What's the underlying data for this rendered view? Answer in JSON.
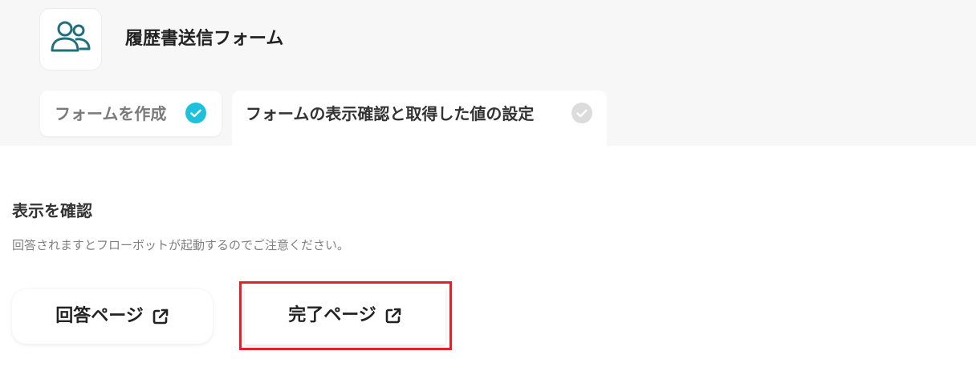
{
  "header": {
    "form_icon": "users-icon",
    "title": "履歴書送信フォーム"
  },
  "tabs": [
    {
      "label": "フォームを作成",
      "status": "done",
      "status_color": "#1ec1dc"
    },
    {
      "label": "フォームの表示確認と取得した値の設定",
      "status": "pending",
      "status_color": "#dcdcdc",
      "active": true
    }
  ],
  "section": {
    "title": "表示を確認",
    "note": "回答されますとフローボットが起動するのでご注意ください。"
  },
  "buttons": {
    "answer_page": {
      "label": "回答ページ",
      "icon": "external-link-icon"
    },
    "complete_page": {
      "label": "完了ページ",
      "icon": "external-link-icon"
    }
  },
  "colors": {
    "accent": "#1ec1dc",
    "icon_teal": "#1f6f7f",
    "highlight": "#e0232a"
  }
}
